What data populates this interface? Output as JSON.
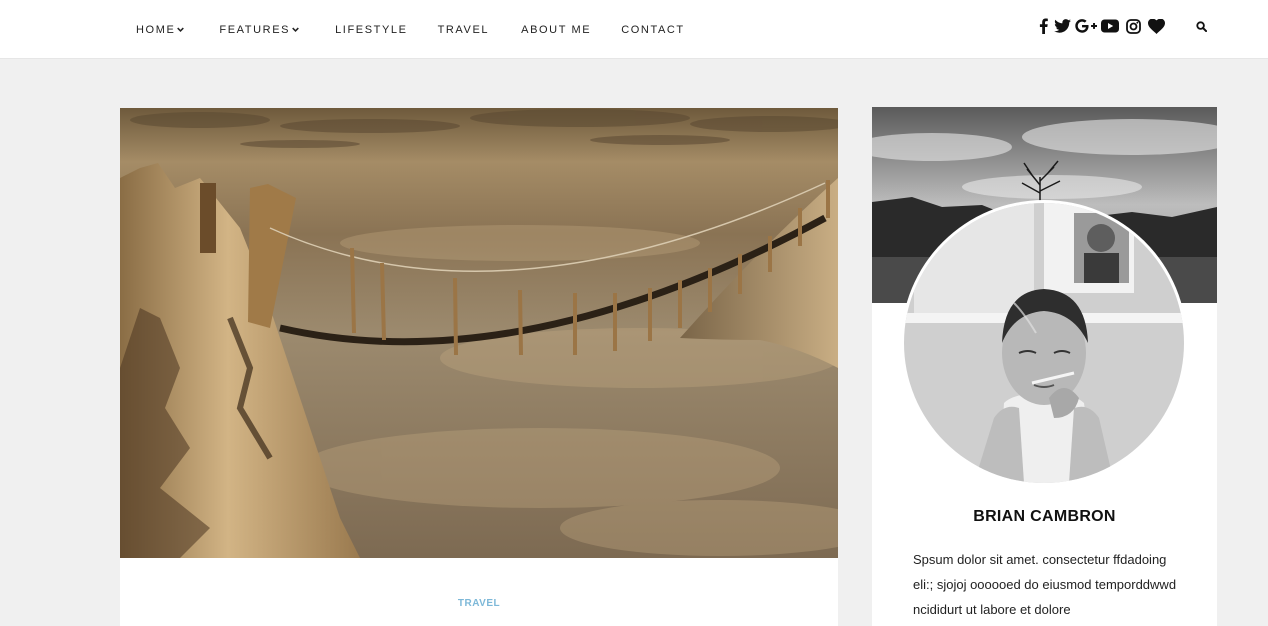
{
  "nav": {
    "items": [
      {
        "label": "HOME",
        "has_dropdown": true
      },
      {
        "label": "FEATURES",
        "has_dropdown": true
      },
      {
        "label": "LIFESTYLE",
        "has_dropdown": false
      },
      {
        "label": "TRAVEL",
        "has_dropdown": false
      },
      {
        "label": "ABOUT ME",
        "has_dropdown": false
      },
      {
        "label": "CONTACT",
        "has_dropdown": false
      }
    ]
  },
  "social": {
    "icons": [
      "facebook-icon",
      "twitter-icon",
      "google-plus-icon",
      "youtube-icon",
      "instagram-icon",
      "heart-icon"
    ]
  },
  "search": {
    "icon": "search-icon"
  },
  "post": {
    "image": "rope-bridge-over-clouds",
    "category": "TRAVEL",
    "category_color": "#7db8d8"
  },
  "author": {
    "cover_image": "black-and-white-lake-landscape",
    "avatar_image": "black-and-white-child-portrait",
    "name": "BRIAN CAMBRON",
    "bio": "Spsum dolor sit amet. consectetur ffdadoing eli:; sjojoj oooooed do eiusmod temporddwwd ncididurt ut labore et dolore"
  },
  "colors": {
    "page_bg": "#f0f0f0",
    "card_bg": "#ffffff",
    "accent": "#7db8d8",
    "text": "#222222"
  }
}
